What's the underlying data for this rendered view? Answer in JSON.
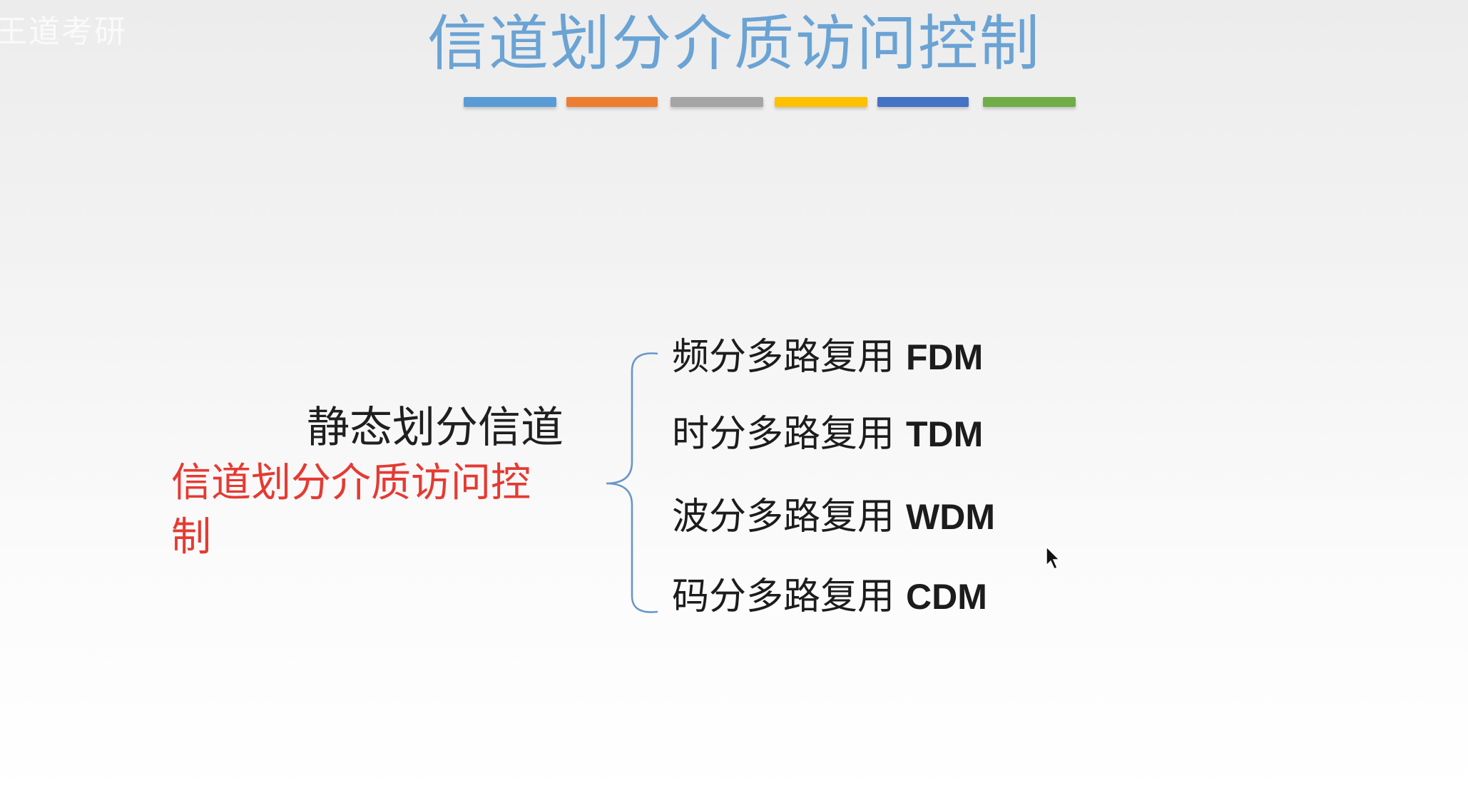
{
  "title": "信道划分介质访问控制",
  "watermark": "王道考研",
  "color_bars": [
    "#5b9bd5",
    "#ed7d31",
    "#a5a5a5",
    "#ffc000",
    "#4472c4",
    "#70ad47"
  ],
  "left": {
    "main_label": "静态划分信道",
    "sub_label": "信道划分介质访问控制",
    "sub_color": "#e53a32"
  },
  "items": [
    {
      "label": "频分多路复用",
      "abbr": "FDM"
    },
    {
      "label": "时分多路复用",
      "abbr": "TDM"
    },
    {
      "label": "波分多路复用",
      "abbr": "WDM"
    },
    {
      "label": "码分多路复用",
      "abbr": "CDM"
    }
  ],
  "icons": {
    "cursor": "mouse-pointer-icon",
    "brace": "left-curly-brace"
  }
}
